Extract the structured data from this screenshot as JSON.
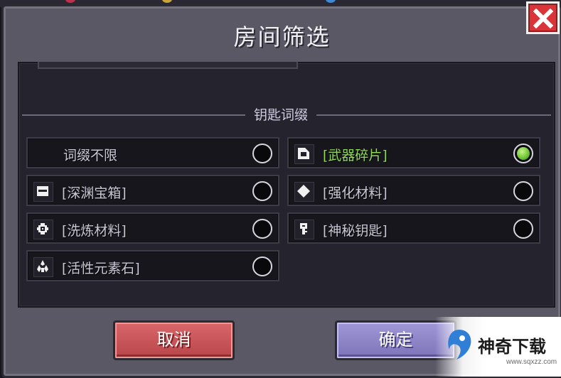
{
  "dialog": {
    "title": "房间筛选",
    "close_icon": "close-x-icon"
  },
  "section": {
    "label": "钥匙词缀"
  },
  "options": [
    {
      "label": "词缀不限",
      "icon": "",
      "selected": false
    },
    {
      "label": "[武器碎片]",
      "icon": "weapon-fragment-icon",
      "selected": true
    },
    {
      "label": "[深渊宝箱]",
      "icon": "abyss-chest-icon",
      "selected": false
    },
    {
      "label": "[强化材料]",
      "icon": "enhance-material-icon",
      "selected": false
    },
    {
      "label": "[洗炼材料]",
      "icon": "refine-material-icon",
      "selected": false
    },
    {
      "label": "[神秘钥匙]",
      "icon": "mystery-key-icon",
      "selected": false
    },
    {
      "label": "[活性元素石]",
      "icon": "element-stone-icon",
      "selected": false
    }
  ],
  "buttons": {
    "cancel": "取消",
    "confirm": "确定"
  },
  "colors": {
    "selected_text": "#8fdc54",
    "cancel": "#c9555a",
    "confirm": "#8f87c8",
    "close": "#d9343a"
  },
  "watermark": {
    "text": "神奇下载",
    "url": "www.sqxzz.com"
  }
}
